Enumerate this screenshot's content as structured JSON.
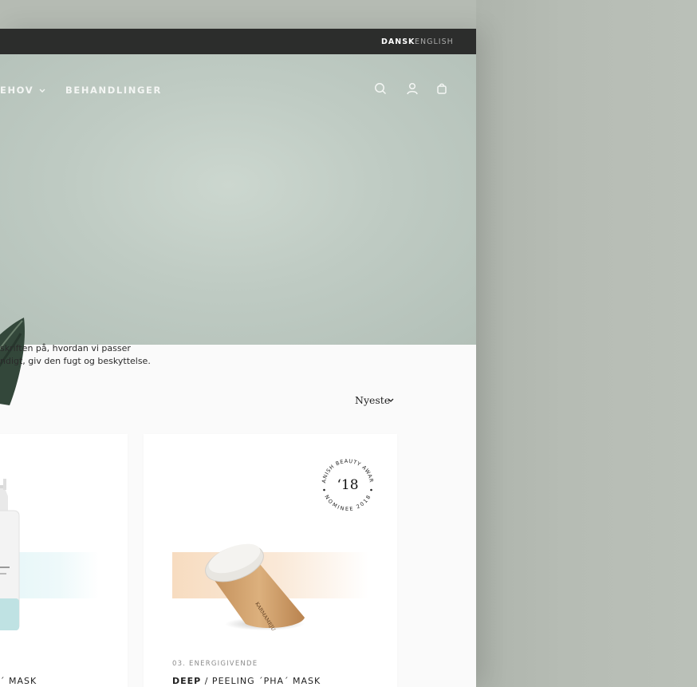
{
  "language_bar": {
    "active": "DANSK",
    "inactive": "ENGLISH"
  },
  "nav": {
    "items": [
      {
        "label": "EHOV"
      },
      {
        "label": "BEHANDLINGER"
      }
    ],
    "icons": [
      "search-icon",
      "account-icon",
      "bag-icon"
    ]
  },
  "intro": {
    "line1": "skriften på, hvordan vi passer",
    "line2": "ndigt, giv den fugt og beskyttelse."
  },
  "sort": {
    "label": "Nyeste"
  },
  "products": [
    {
      "name_suffix": "MASK"
    },
    {
      "category": "03. ENERGIGIVENDE",
      "name_bold": "DEEP",
      "name_rest": " / PEELING ´PHA´ MASK",
      "award": {
        "top": "DANISH BEAUTY AWARD",
        "year": "‘18",
        "bottom": "NOMINEE 2018"
      },
      "brand_mark": "KARMAMEJU"
    }
  ],
  "colors": {
    "topbar": "#2c2d2c",
    "hero": "#c4cfc7",
    "page_bg": "#b5bbb3",
    "band_blue": "#e6f6f8",
    "band_peach": "#f7dcc0"
  }
}
